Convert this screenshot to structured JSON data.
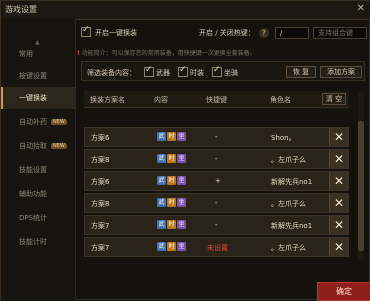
{
  "window": {
    "title": "游戏设置",
    "close": "✕"
  },
  "sidebar": {
    "items": [
      {
        "label": "常用"
      },
      {
        "label": "按键设置"
      },
      {
        "label": "一键换装"
      },
      {
        "label": "自动补药",
        "badge": "NEW"
      },
      {
        "label": "自动拾取",
        "badge": "NEW"
      },
      {
        "label": "技能设置"
      },
      {
        "label": "辅助功能"
      },
      {
        "label": "DPS统计"
      },
      {
        "label": "技能计时"
      }
    ]
  },
  "top": {
    "enable_label": "开启一键换装",
    "hotkey_label": "开启 / 关闭热键：",
    "help": "?",
    "hotkey_value": "/",
    "note_placeholder": "支持组合键",
    "hint_prefix": "功能简介：",
    "hint_text": "可以保存您的常用装备，用快捷键一次更换全套装备。"
  },
  "filter": {
    "label": "筛选装备内容：",
    "options": [
      "武器",
      "时装",
      "坐骑"
    ],
    "btn_reset": "恢 复",
    "btn_add": "添加方案"
  },
  "table": {
    "headers": [
      "换装方案名",
      "内容",
      "快捷键",
      "角色名"
    ],
    "clear_btn": "清 空",
    "rows": [
      {
        "name": "方案6",
        "hotkey": "-",
        "role": "Shon。"
      },
      {
        "name": "方案8",
        "hotkey": "-",
        "role": "。左爪子么"
      },
      {
        "name": "方案6",
        "hotkey": "+",
        "role": "新解先兵no1"
      },
      {
        "name": "方案8",
        "hotkey": "-",
        "role": "。左爪子么"
      },
      {
        "name": "方案7",
        "hotkey": "-",
        "role": "新解先兵no1"
      },
      {
        "name": "方案7",
        "hotkey": "未设置",
        "role": "。左爪子么"
      }
    ],
    "chips": [
      "武",
      "时",
      "坐"
    ]
  },
  "footer": {
    "confirm": "确定"
  },
  "colors": {
    "accent": "#8e1f1b",
    "highlight": "#c89c4a"
  }
}
